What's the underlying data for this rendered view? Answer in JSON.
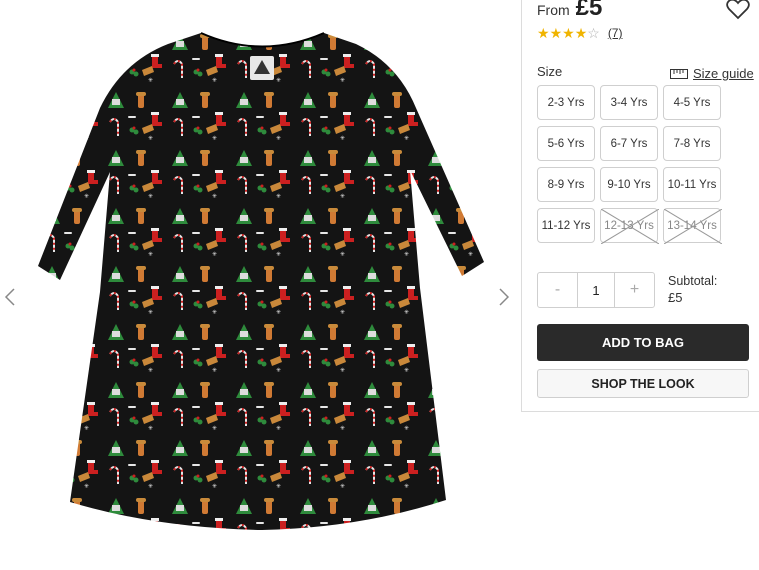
{
  "product": {
    "price_prefix": "From",
    "price": "£5",
    "rating": 4,
    "rating_max": 5,
    "review_count": "(7)"
  },
  "sizes": {
    "label": "Size",
    "guide_label": "Size guide",
    "options": [
      {
        "label": "2-3 Yrs",
        "available": true
      },
      {
        "label": "3-4 Yrs",
        "available": true
      },
      {
        "label": "4-5 Yrs",
        "available": true
      },
      {
        "label": "5-6 Yrs",
        "available": true
      },
      {
        "label": "6-7 Yrs",
        "available": true
      },
      {
        "label": "7-8 Yrs",
        "available": true
      },
      {
        "label": "8-9 Yrs",
        "available": true
      },
      {
        "label": "9-10 Yrs",
        "available": true
      },
      {
        "label": "10-11 Yrs",
        "available": true
      },
      {
        "label": "11-12 Yrs",
        "available": true
      },
      {
        "label": "12-13 Yrs",
        "available": false
      },
      {
        "label": "13-14 Yrs",
        "available": false
      }
    ]
  },
  "quantity": {
    "minus": "-",
    "value": "1",
    "plus": "+"
  },
  "subtotal": {
    "label": "Subtotal:",
    "value": "£5"
  },
  "actions": {
    "add_to_bag": "ADD TO BAG",
    "shop_the_look": "SHOP THE LOOK"
  },
  "colors": {
    "star": "#f0b400",
    "primary_button": "#2a2a2a",
    "dress": "#141414"
  }
}
